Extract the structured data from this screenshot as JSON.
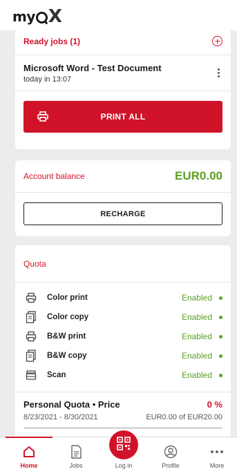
{
  "app": {
    "logo_text": "my",
    "logo_suffix": "X"
  },
  "ready_jobs": {
    "title": "Ready jobs (1)",
    "jobs": [
      {
        "name": "Microsoft Word - Test Document",
        "time": "today in 13:07"
      }
    ],
    "print_all_label": "PRINT ALL"
  },
  "account": {
    "title": "Account balance",
    "balance": "EUR0.00",
    "recharge_label": "RECHARGE"
  },
  "quota": {
    "title": "Quota",
    "items": [
      {
        "label": "Color print",
        "status": "Enabled",
        "icon": "printer-icon"
      },
      {
        "label": "Color copy",
        "status": "Enabled",
        "icon": "copy-icon"
      },
      {
        "label": "B&W print",
        "status": "Enabled",
        "icon": "printer-icon"
      },
      {
        "label": "B&W copy",
        "status": "Enabled",
        "icon": "copy-icon"
      },
      {
        "label": "Scan",
        "status": "Enabled",
        "icon": "scanner-icon"
      }
    ],
    "personal": {
      "title": "Personal Quota • Price",
      "percent": "0 %",
      "dates": "8/23/2021 - 8/30/2021",
      "amount": "EUR0.00 of EUR20.00",
      "progress_fraction": 0
    }
  },
  "nav": {
    "home": "Home",
    "jobs": "Jobs",
    "login": "Log in",
    "profile": "Profile",
    "more": "More"
  },
  "colors": {
    "accent": "#d1132a",
    "success": "#5aa021"
  }
}
